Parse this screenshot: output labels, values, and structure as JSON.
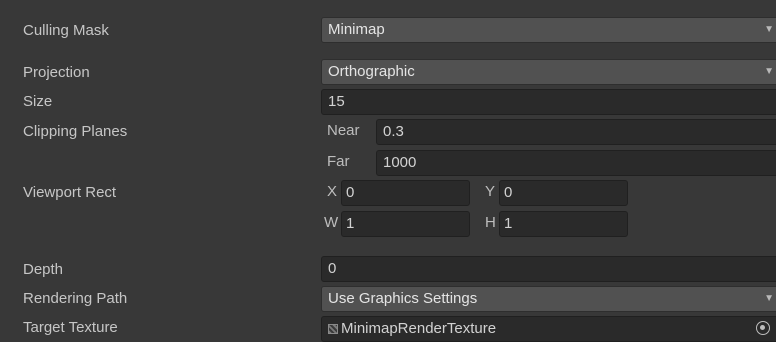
{
  "camera": {
    "culling_mask": {
      "label": "Culling Mask",
      "value": "Minimap"
    },
    "projection": {
      "label": "Projection",
      "value": "Orthographic"
    },
    "size": {
      "label": "Size",
      "value": "15"
    },
    "clipping_planes": {
      "label": "Clipping Planes",
      "near_label": "Near",
      "near_value": "0.3",
      "far_label": "Far",
      "far_value": "1000"
    },
    "viewport_rect": {
      "label": "Viewport Rect",
      "x_label": "X",
      "x_value": "0",
      "y_label": "Y",
      "y_value": "0",
      "w_label": "W",
      "w_value": "1",
      "h_label": "H",
      "h_value": "1"
    },
    "depth": {
      "label": "Depth",
      "value": "0"
    },
    "rendering_path": {
      "label": "Rendering Path",
      "value": "Use Graphics Settings"
    },
    "target_texture": {
      "label": "Target Texture",
      "value": "MinimapRenderTexture"
    }
  },
  "icons": {
    "dropdown": "chevron-down-icon",
    "texture": "render-texture-icon",
    "object_picker": "object-picker-icon"
  }
}
